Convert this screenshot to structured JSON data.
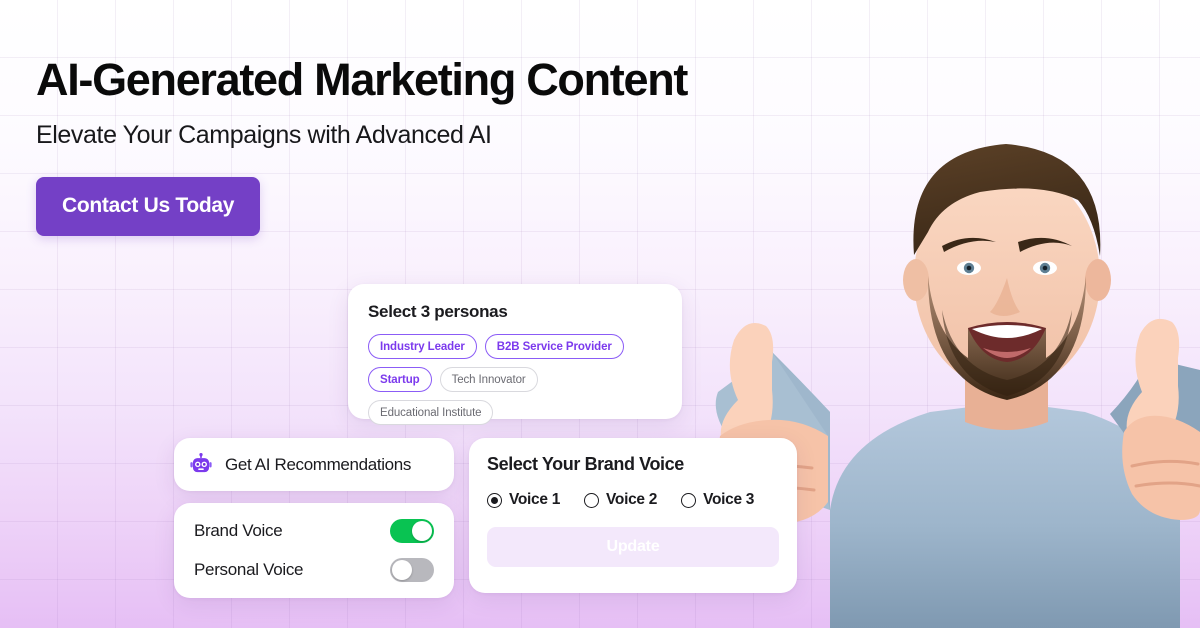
{
  "hero": {
    "headline": "AI-Generated Marketing Content",
    "subheadline": "Elevate Your Campaigns with Advanced AI",
    "cta_label": "Contact Us Today"
  },
  "personas": {
    "title": "Select 3 personas",
    "chips": [
      {
        "label": "Industry Leader",
        "selected": true
      },
      {
        "label": "B2B Service Provider",
        "selected": true
      },
      {
        "label": "Startup",
        "selected": true
      },
      {
        "label": "Tech Innovator",
        "selected": false
      },
      {
        "label": "Educational Institute",
        "selected": false
      }
    ]
  },
  "ai_recommendations": {
    "label": "Get AI Recommendations",
    "icon": "robot-icon"
  },
  "voice_toggles": [
    {
      "label": "Brand Voice",
      "state": "on"
    },
    {
      "label": "Personal Voice",
      "state": "off"
    }
  ],
  "brand_voice": {
    "title": "Select Your Brand Voice",
    "options": [
      {
        "label": "Voice 1",
        "checked": true
      },
      {
        "label": "Voice 2",
        "checked": false
      },
      {
        "label": "Voice 3",
        "checked": false
      }
    ],
    "update_label": "Update"
  },
  "photo": {
    "description": "smiling bearded man in light blue sweater giving two thumbs up"
  },
  "colors": {
    "accent_purple": "#7440c6",
    "chip_selected_border": "#8b5cf6",
    "chip_selected_text": "#7c3aed",
    "toggle_on": "#09c352",
    "toggle_off": "#b8b8bd",
    "update_bg": "#f3e8fb",
    "bg_gradient_top": "#ffffff",
    "bg_gradient_bottom": "#e6bff5"
  }
}
